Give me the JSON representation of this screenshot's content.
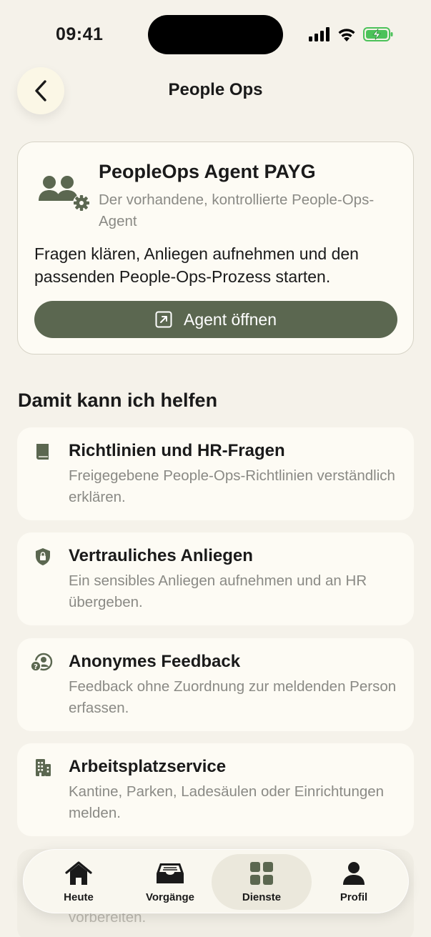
{
  "status_bar": {
    "time": "09:41"
  },
  "header": {
    "title": "People Ops"
  },
  "agent_card": {
    "title": "PeopleOps Agent PAYG",
    "subtitle": "Der vorhandene, kontrollierte People-Ops-Agent",
    "description": "Fragen klären, Anliegen aufnehmen und den passenden People-Ops-Prozess starten.",
    "button_label": "Agent öffnen"
  },
  "section": {
    "title": "Damit kann ich helfen"
  },
  "services": [
    {
      "icon": "book-icon",
      "title": "Richtlinien und HR-Fragen",
      "description": "Freigegebene People-Ops-Richtlinien verständlich erklären."
    },
    {
      "icon": "shield-lock-icon",
      "title": "Vertrauliches Anliegen",
      "description": "Ein sensibles Anliegen aufnehmen und an HR übergeben."
    },
    {
      "icon": "anonymous-person-icon",
      "title": "Anonymes Feedback",
      "description": "Feedback ohne Zuordnung zur meldenden Person erfassen."
    },
    {
      "icon": "building-icon",
      "title": "Arbeitsplatzservice",
      "description": "Kantine, Parken, Ladesäulen oder Einrichtungen melden."
    }
  ],
  "ghost_card": {
    "text": "vorbereiten."
  },
  "tab_bar": {
    "tabs": [
      {
        "label": "Heute",
        "icon": "home-icon"
      },
      {
        "label": "Vorgänge",
        "icon": "inbox-tray-icon"
      },
      {
        "label": "Dienste",
        "icon": "grid-icon"
      },
      {
        "label": "Profil",
        "icon": "person-icon"
      }
    ],
    "active": "Dienste"
  },
  "colors": {
    "accent": "#5b6750",
    "background": "#f5f2ea",
    "card": "#fdfbf4",
    "muted_text": "#8a8a85"
  }
}
